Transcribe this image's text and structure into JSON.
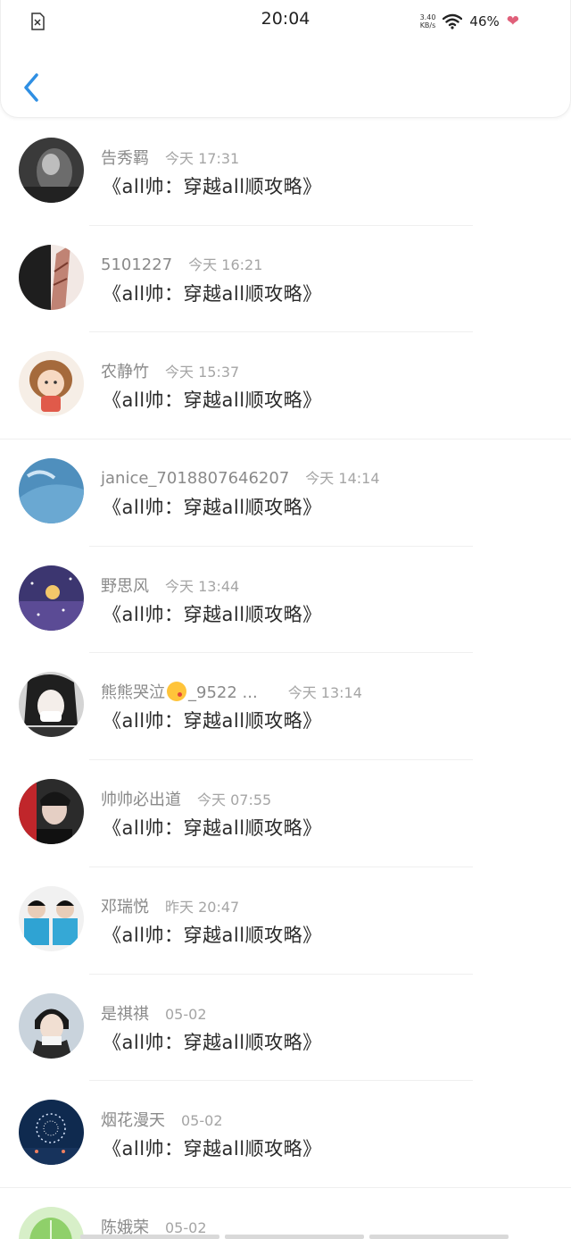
{
  "status_bar": {
    "time": "20:04",
    "net_speed_value": "3.40",
    "net_speed_unit": "KB/s",
    "battery": "46%",
    "left_icon": "sim-off-icon",
    "wifi_icon": "wifi-icon",
    "heart_icon": "heart-icon"
  },
  "header": {
    "back_icon": "chevron-left-icon",
    "accent_color": "#2f8fe3"
  },
  "list": {
    "items": [
      {
        "name": "告秀羁",
        "time": "今天 17:31",
        "message": "《all帅：穿越all顺攻略》"
      },
      {
        "name": "5101227",
        "time": "今天 16:21",
        "message": "《all帅：穿越all顺攻略》"
      },
      {
        "name": "农静竹",
        "time": "今天 15:37",
        "message": "《all帅：穿越all顺攻略》"
      },
      {
        "name": "janice_7018807646207",
        "time": "今天 14:14",
        "message": "《all帅：穿越all顺攻略》"
      },
      {
        "name": "野思风",
        "time": "今天 13:44",
        "message": "《all帅：穿越all顺攻略》"
      },
      {
        "name_prefix": "熊熊哭泣",
        "name_suffix": "_9522 ...",
        "time": "今天 13:14",
        "message": "《all帅：穿越all顺攻略》"
      },
      {
        "name": "帅帅必出道",
        "time": "今天 07:55",
        "message": "《all帅：穿越all顺攻略》"
      },
      {
        "name": "邓瑞悦",
        "time": "昨天 20:47",
        "message": "《all帅：穿越all顺攻略》"
      },
      {
        "name": "是祺祺",
        "time": "05-02",
        "message": "《all帅：穿越all顺攻略》"
      },
      {
        "name": "烟花漫天",
        "time": "05-02",
        "message": "《all帅：穿越all顺攻略》"
      },
      {
        "name": "陈娥荣",
        "time": "05-02",
        "message": ""
      }
    ]
  }
}
